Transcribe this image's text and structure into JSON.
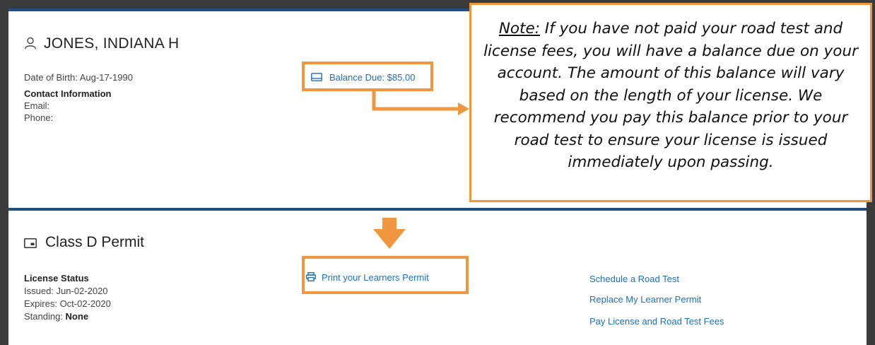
{
  "person": {
    "name": "JONES, INDIANA H",
    "dob": "Date of Birth: Aug-17-1990",
    "contact_heading": "Contact Information",
    "email_label": "Email:",
    "phone_label": "Phone:"
  },
  "balance": {
    "label": "Balance Due: $85.00"
  },
  "note": {
    "prefix": "Note:",
    "text": " If you have not paid your road test and license fees, you will have a balance due on your account. The amount of this balance will vary based on the length of your license. We recommend you pay this balance prior to your road test to ensure your license is issued immediately upon passing."
  },
  "permit": {
    "title": "Class D Permit",
    "status_heading": "License Status",
    "issued": "Issued:  Jun-02-2020",
    "expires": "Expires: Oct-02-2020",
    "standing_label": "Standing: ",
    "standing_value": "None",
    "print_label": "Print your Learners Permit"
  },
  "actions": [
    "Schedule a Road Test",
    "Replace My Learner Permit",
    "Pay License and Road Test Fees"
  ],
  "colors": {
    "accent": "#f0963f",
    "link": "#1f6fbf",
    "header_bar": "#1f4e84",
    "background": "#3b3b3b"
  },
  "icons": [
    "person-icon",
    "card-icon",
    "id-card-icon",
    "printer-icon",
    "arrow-right-icon",
    "arrow-down-icon"
  ]
}
